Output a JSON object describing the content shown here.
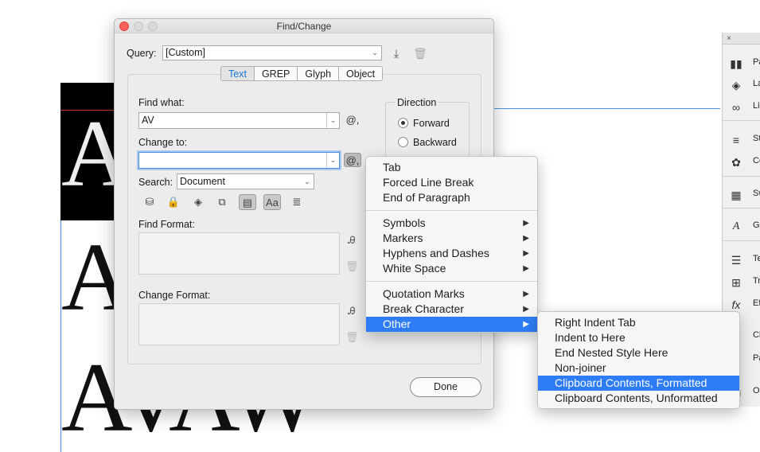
{
  "dialog": {
    "title": "Find/Change",
    "query_label": "Query:",
    "query_value": "[Custom]",
    "tabs": [
      {
        "label": "Text",
        "active": true
      },
      {
        "label": "GREP",
        "active": false
      },
      {
        "label": "Glyph",
        "active": false
      },
      {
        "label": "Object",
        "active": false
      }
    ],
    "find_what_label": "Find what:",
    "find_what_value": "AV",
    "change_to_label": "Change to:",
    "change_to_value": "",
    "direction_label": "Direction",
    "forward_label": "Forward",
    "backward_label": "Backward",
    "direction_selected": "Forward",
    "search_label": "Search:",
    "search_value": "Document",
    "special_char_symbol": "@,",
    "find_format_label": "Find Format:",
    "change_format_label": "Change Format:",
    "done_label": "Done",
    "accent_color": "#1a78d6"
  },
  "special_menu": {
    "groups": [
      [
        {
          "label": "Tab",
          "submenu": false
        },
        {
          "label": "Forced Line Break",
          "submenu": false
        },
        {
          "label": "End of Paragraph",
          "submenu": false
        }
      ],
      [
        {
          "label": "Symbols",
          "submenu": true
        },
        {
          "label": "Markers",
          "submenu": true
        },
        {
          "label": "Hyphens and Dashes",
          "submenu": true
        },
        {
          "label": "White Space",
          "submenu": true
        }
      ],
      [
        {
          "label": "Quotation Marks",
          "submenu": true
        },
        {
          "label": "Break Character",
          "submenu": true
        },
        {
          "label": "Other",
          "submenu": true,
          "selected": true
        }
      ]
    ]
  },
  "other_submenu": {
    "items": [
      {
        "label": "Right Indent Tab",
        "selected": false
      },
      {
        "label": "Indent to Here",
        "selected": false
      },
      {
        "label": "End Nested Style Here",
        "selected": false
      },
      {
        "label": "Non-joiner",
        "selected": false
      },
      {
        "label": "Clipboard Contents, Formatted",
        "selected": true
      },
      {
        "label": "Clipboard Contents, Unformatted",
        "selected": false
      }
    ],
    "highlight_color": "#2f7df6"
  },
  "canvas": {
    "glyph_a1": "A",
    "glyph_a2": "A",
    "glyph_a3": "AVAW"
  },
  "right_panel": {
    "close_symbol": "×",
    "items": [
      {
        "label": "Pa",
        "icon": "pages-icon"
      },
      {
        "label": "La",
        "icon": "layers-icon"
      },
      {
        "label": "Li",
        "icon": "links-icon"
      },
      {
        "label": "St",
        "icon": "stroke-icon"
      },
      {
        "label": "Co",
        "icon": "color-icon"
      },
      {
        "label": "Sw",
        "icon": "swatches-icon"
      },
      {
        "label": "Gl",
        "icon": "glyphs-icon"
      },
      {
        "label": "Te",
        "icon": "text-wrap-icon"
      },
      {
        "label": "Tr",
        "icon": "transform-icon"
      },
      {
        "label": "Ef",
        "icon": "effects-icon"
      },
      {
        "label": "Cl",
        "icon": "character-icon"
      },
      {
        "label": "Pa",
        "icon": "paragraph-icon"
      },
      {
        "label": "O",
        "icon": "object-icon"
      }
    ]
  }
}
